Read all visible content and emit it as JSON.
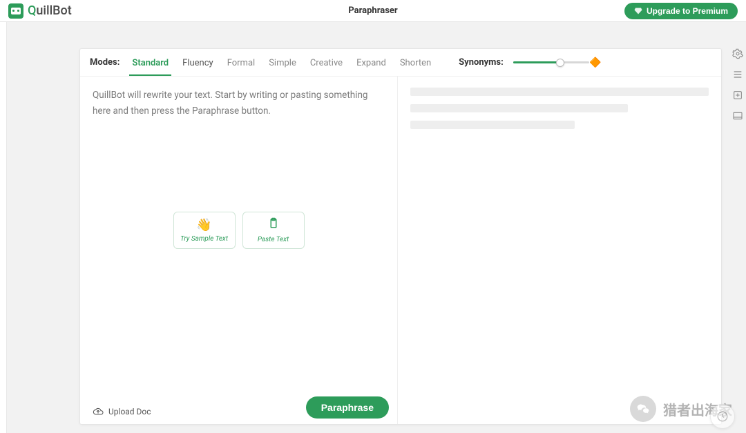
{
  "brand": {
    "name": "QuillBot"
  },
  "header": {
    "title": "Paraphraser",
    "upgrade_label": "Upgrade to Premium"
  },
  "modes": {
    "label": "Modes:",
    "items": [
      {
        "label": "Standard",
        "active": true
      },
      {
        "label": "Fluency"
      },
      {
        "label": "Formal"
      },
      {
        "label": "Simple"
      },
      {
        "label": "Creative"
      },
      {
        "label": "Expand"
      },
      {
        "label": "Shorten"
      }
    ]
  },
  "synonyms": {
    "label": "Synonyms:",
    "value_percent": 62
  },
  "editor": {
    "placeholder": "QuillBot will rewrite your text. Start by writing or pasting something here and then press the Paraphrase button.",
    "try_sample_label": "Try Sample Text",
    "paste_label": "Paste Text",
    "upload_label": "Upload Doc",
    "paraphrase_label": "Paraphrase"
  },
  "watermark": {
    "text": "猎者出海家"
  },
  "colors": {
    "accent": "#2d9c5a"
  }
}
